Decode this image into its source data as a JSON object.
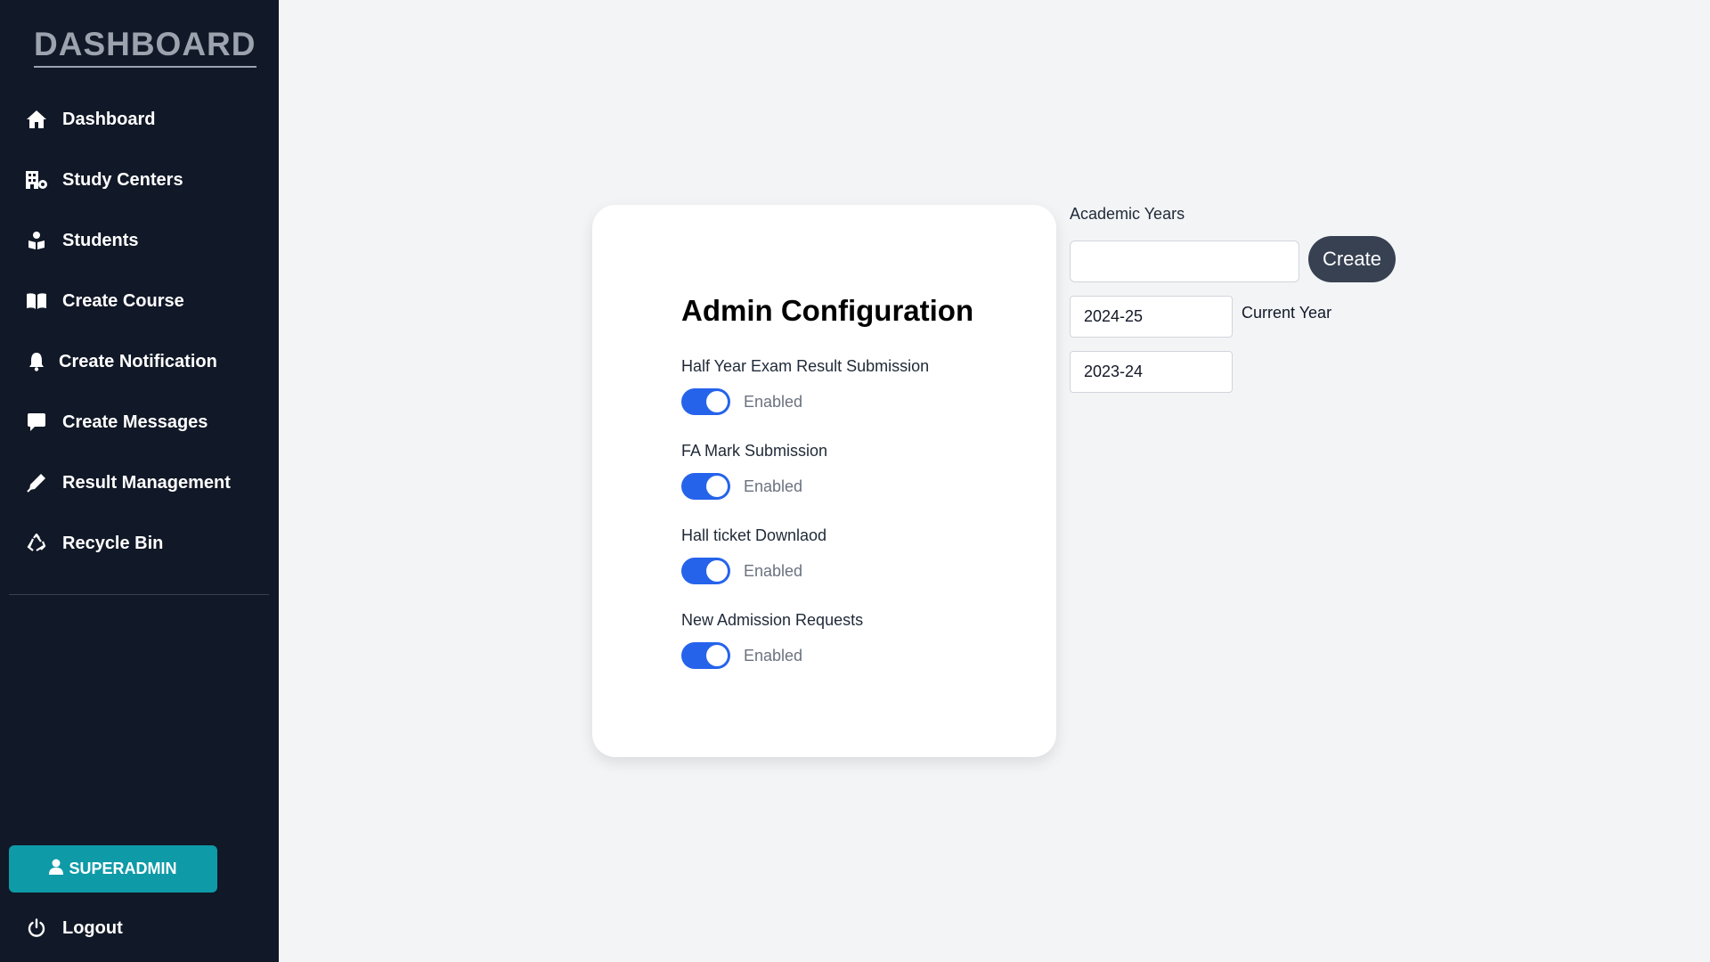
{
  "sidebar": {
    "brand": "DASHBOARD",
    "items": [
      {
        "label": "Dashboard",
        "icon": "home-icon"
      },
      {
        "label": "Study Centers",
        "icon": "building-icon"
      },
      {
        "label": "Students",
        "icon": "students-icon"
      },
      {
        "label": "Create Course",
        "icon": "book-icon"
      },
      {
        "label": "Create Notification",
        "icon": "bell-icon"
      },
      {
        "label": "Create Messages",
        "icon": "message-icon"
      },
      {
        "label": "Result Management",
        "icon": "pen-icon"
      },
      {
        "label": "Recycle Bin",
        "icon": "recycle-icon"
      }
    ],
    "user_button": "SUPERADMIN",
    "logout_label": "Logout"
  },
  "config": {
    "title": "Admin Configuration",
    "settings": [
      {
        "label": "Half Year Exam Result Submission",
        "state": "Enabled",
        "enabled": true
      },
      {
        "label": "FA Mark Submission",
        "state": "Enabled",
        "enabled": true
      },
      {
        "label": "Hall ticket Downlaod",
        "state": "Enabled",
        "enabled": true
      },
      {
        "label": "New Admission Requests",
        "state": "Enabled",
        "enabled": true
      }
    ]
  },
  "academic_years": {
    "title": "Academic Years",
    "input_value": "",
    "create_label": "Create",
    "years": [
      "2024-25",
      "2023-24"
    ],
    "current_label": "Current Year"
  },
  "colors": {
    "sidebar_bg": "#111827",
    "accent": "#2563eb",
    "user_button": "#0e9aa7",
    "create_button": "#374151"
  }
}
